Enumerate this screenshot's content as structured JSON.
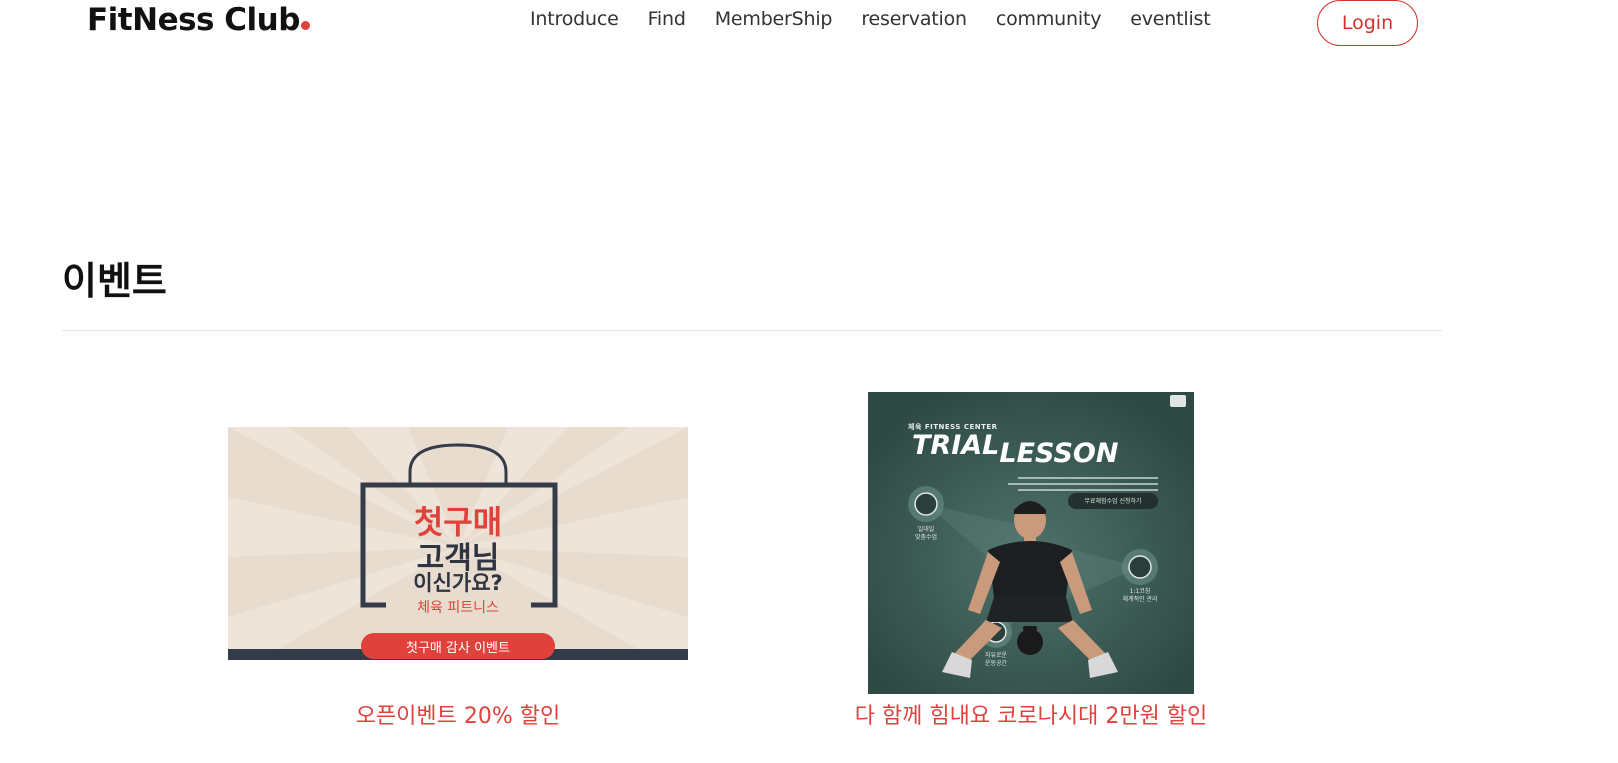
{
  "header": {
    "logo_text": "FitNess Club",
    "nav": [
      "Introduce",
      "Find",
      "MemberShip",
      "reservation",
      "community",
      "eventlist"
    ],
    "login_label": "Login"
  },
  "section": {
    "title": "이벤트"
  },
  "events": [
    {
      "title": "오픈이벤트 20% 할인",
      "banner": {
        "line1": "첫구매",
        "line2": "고객님",
        "line3": "이신가요?",
        "brand": "체육 피트니스",
        "cta": "첫구매 감사 이벤트"
      }
    },
    {
      "title": "다 함께 힘내요 코로나시대 2만원 할인",
      "banner": {
        "kicker": "체육 FITNESS CENTER",
        "headline_a": "TRIAL",
        "headline_b": "LESSON",
        "pill": "무료체험수업 신청하기",
        "badge1": "일대일\n맞춤수업",
        "badge2": "1:1코칭\n체계적인 관리",
        "badge3": "자유로운\n운동공간"
      }
    }
  ],
  "colors": {
    "accent": "#e0413b",
    "banner_bg_1": "#e8dccf",
    "banner_bg_2": "#3a5a54",
    "text": "#111111"
  }
}
